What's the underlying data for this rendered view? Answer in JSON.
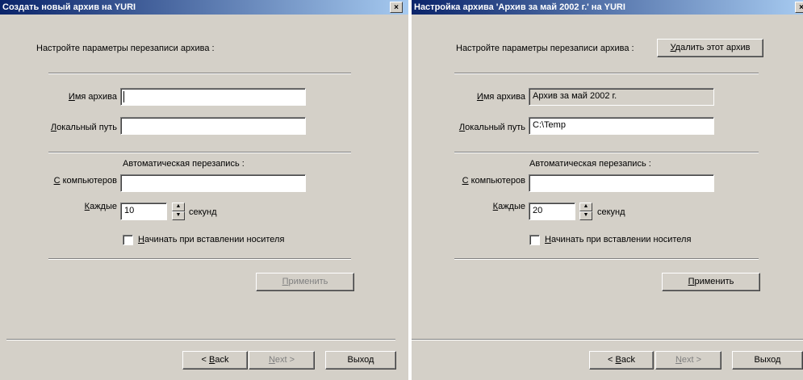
{
  "dialog_new": {
    "title": "Создать новый архив на YURI",
    "close_glyph": "×",
    "intro": "Настройте параметры перезаписи архива :",
    "name_label": "Имя архива",
    "name_access_key": "И",
    "name_label_rest": "мя архива",
    "name_value": "",
    "path_label": "Локальный путь",
    "path_access_key": "Л",
    "path_label_rest": "окальный путь",
    "path_value": "",
    "auto_label": "Автоматическая перезапись :",
    "from_label": "С компьютеров",
    "from_access_key": "С",
    "from_label_rest": " компьютеров",
    "from_value": "",
    "every_label": "Каждые",
    "every_access_key": "К",
    "every_label_rest": "аждые",
    "every_value": "10",
    "seconds_label": "секунд",
    "start_checkbox_label": "Начинать при вставлении носителя",
    "start_access_key": "Н",
    "start_label_rest": "ачинать при вставлении носителя",
    "start_checked": false,
    "apply_button": "Применить",
    "apply_access_key": "П",
    "apply_button_rest": "рименить",
    "apply_enabled": false,
    "back_button": "< Back",
    "back_prefix": "< ",
    "back_access_key": "B",
    "back_rest": "ack",
    "next_button": "Next >",
    "next_access_key": "N",
    "next_rest": "ext >",
    "next_enabled": false,
    "exit_button": "Выход"
  },
  "dialog_edit": {
    "title": "Настройка архива 'Архив за май 2002 г.' на YURI",
    "close_glyph": "×",
    "intro": "Настройте параметры перезаписи архива :",
    "delete_button": "Удалить этот архив",
    "delete_access_key": "У",
    "delete_button_rest": "далить этот архив",
    "name_label": "Имя архива",
    "name_access_key": "И",
    "name_label_rest": "мя архива",
    "name_value": "Архив за май 2002 г.",
    "name_readonly": true,
    "path_label": "Локальный путь",
    "path_access_key": "Л",
    "path_label_rest": "окальный путь",
    "path_value": "C:\\Temp",
    "auto_label": "Автоматическая перезапись :",
    "from_label": "С компьютеров",
    "from_access_key": "С",
    "from_label_rest": " компьютеров",
    "from_value": "",
    "every_label": "Каждые",
    "every_access_key": "К",
    "every_label_rest": "аждые",
    "every_value": "20",
    "seconds_label": "секунд",
    "start_checkbox_label": "Начинать при вставлении носителя",
    "start_access_key": "Н",
    "start_label_rest": "ачинать при вставлении носителя",
    "start_checked": false,
    "apply_button": "Применить",
    "apply_access_key": "П",
    "apply_button_rest": "рименить",
    "apply_enabled": true,
    "back_button": "< Back",
    "back_prefix": "< ",
    "back_access_key": "B",
    "back_rest": "ack",
    "next_button": "Next >",
    "next_access_key": "N",
    "next_rest": "ext >",
    "next_enabled": false,
    "exit_button": "Выход"
  },
  "icons": {
    "spin_up": "▲",
    "spin_down": "▼"
  },
  "colors": {
    "title_start": "#0a246a",
    "title_end": "#a6caf0",
    "face": "#d4d0c8",
    "disabled_text": "#808080"
  }
}
